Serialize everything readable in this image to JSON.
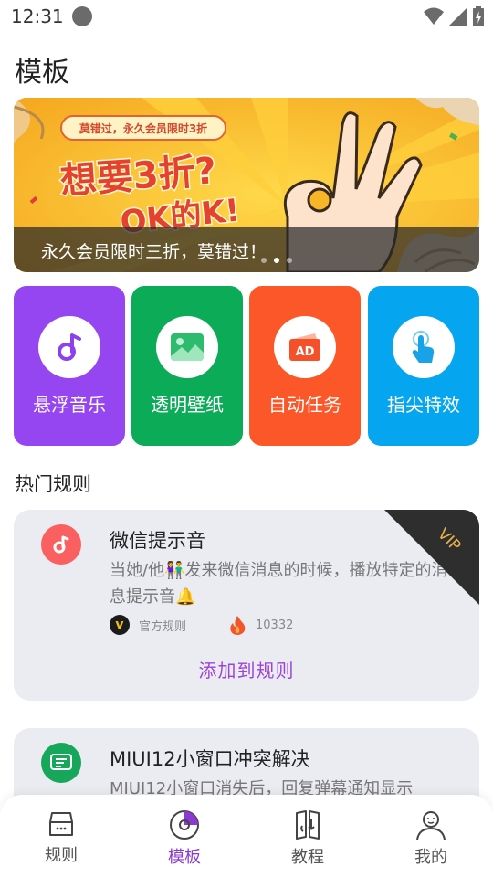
{
  "status_bar": {
    "time": "12:31"
  },
  "page_title": "模板",
  "banner": {
    "tag_text": "莫错过，永久会员限时3折",
    "headline": "想要3折?",
    "headline2": "OK的K!",
    "caption": "永久会员限时三折，莫错过！",
    "dots": 3,
    "active_dot": 1
  },
  "tiles": [
    {
      "label": "悬浮音乐",
      "icon": "music-note-icon",
      "color": "#9646f0"
    },
    {
      "label": "透明壁纸",
      "icon": "wallpaper-icon",
      "color": "#0cab58"
    },
    {
      "label": "自动任务",
      "icon": "ad-icon",
      "color": "#fb5728"
    },
    {
      "label": "指尖特效",
      "icon": "touch-icon",
      "color": "#05a6ef"
    }
  ],
  "section_title": "热门规则",
  "rules": [
    {
      "title": "微信提示音",
      "description": "当她/他👫发来微信消息的时候，播放特定的消息提示音🔔",
      "source": "官方规则",
      "heat": "10332",
      "action": "添加到规则",
      "badge": "VIP",
      "icon": "music-note-icon",
      "icon_color": "#fb6061"
    },
    {
      "title": "MIUI12小窗口冲突解决",
      "description": "MIUI12小窗口消失后，回复弹幕通知显示",
      "icon": "message-icon",
      "icon_color": "#16a75b"
    }
  ],
  "bottom_nav": [
    {
      "label": "规则",
      "icon": "rules-box-icon",
      "active": false
    },
    {
      "label": "模板",
      "icon": "template-disc-icon",
      "active": true
    },
    {
      "label": "教程",
      "icon": "tutorial-book-icon",
      "active": false
    },
    {
      "label": "我的",
      "icon": "profile-icon",
      "active": false
    }
  ],
  "colors": {
    "accent": "#8a3ad0",
    "card_bg": "#ebecf2",
    "vip_gold": "#e8b24a"
  }
}
